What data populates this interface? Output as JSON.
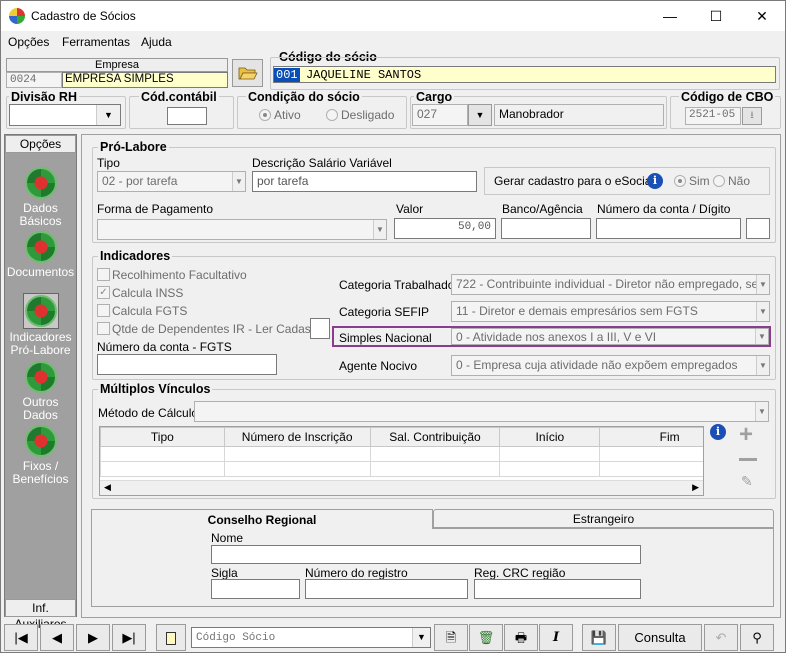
{
  "window": {
    "title": "Cadastro de Sócios",
    "minimize": "—",
    "maximize": "☐",
    "close": "✕"
  },
  "menu": {
    "opcoes": "Opções",
    "ferramentas": "Ferramentas",
    "ajuda": "Ajuda"
  },
  "empresa": {
    "header": "Empresa",
    "code": "0024",
    "name": "EMPRESA SIMPLES"
  },
  "socio": {
    "label": "Código do sócio",
    "code": "001",
    "name": "JAQUELINE SANTOS"
  },
  "top_row": {
    "divisao_label": "Divisão RH",
    "cod_contabil_label": "Cód.contábil",
    "condicao_label": "Condição do sócio",
    "ativo": "Ativo",
    "desligado": "Desligado",
    "cargo_label": "Cargo",
    "cargo_code": "027",
    "cargo_name": "Manobrador",
    "cbo_label": "Código de CBO",
    "cbo_value": "2521-05"
  },
  "sidebar": {
    "header": "Opções",
    "items": [
      {
        "label": "Dados Básicos"
      },
      {
        "label": "Documentos"
      },
      {
        "label": "Indicadores Pró-Labore"
      },
      {
        "label": "Outros Dados"
      },
      {
        "label": "Fixos / Benefícios"
      }
    ],
    "footer": "Inf. Auxiliares"
  },
  "pro_labore": {
    "title": "Pró-Labore",
    "tipo_label": "Tipo",
    "tipo_value": "02 - por tarefa",
    "desc_label": "Descrição Salário Variável",
    "desc_value": "por tarefa",
    "esocial_label": "Gerar cadastro para o eSocial:",
    "sim": "Sim",
    "nao": "Não",
    "forma_label": "Forma de Pagamento",
    "valor_label": "Valor",
    "valor_value": "50,00",
    "banco_label": "Banco/Agência",
    "conta_label": "Número da conta / Dígito"
  },
  "indicadores": {
    "title": "Indicadores",
    "recolhimento": "Recolhimento Facultativo",
    "calcula_inss": "Calcula INSS",
    "calcula_fgts": "Calcula FGTS",
    "qtde_dependentes": "Qtde de Dependentes IR - Ler Cadastro",
    "conta_fgts_label": "Número da conta - FGTS",
    "cat_trab_label": "Categoria Trabalhador",
    "cat_trab_value": "722 - Contribuinte individual - Diretor não empregado, sem FG",
    "cat_sefip_label": "Categoria SEFIP",
    "cat_sefip_value": "11 - Diretor e demais empresários sem FGTS",
    "simples_label": "Simples Nacional",
    "simples_value": "0 - Atividade nos anexos I a III, V e VI",
    "agente_label": "Agente Nocivo",
    "agente_value": "0 - Empresa cuja atividade não expõem empregados"
  },
  "multiplos": {
    "title": "Múltiplos Vínculos",
    "metodo_label": "Método de Cálculo",
    "columns": [
      "Tipo",
      "Número de Inscrição",
      "Sal. Contribuição",
      "Início",
      "Fim"
    ]
  },
  "conselho": {
    "tab1": "Conselho Regional",
    "tab2": "Estrangeiro",
    "nome_label": "Nome",
    "sigla_label": "Sigla",
    "numero_label": "Número do registro",
    "reg_label": "Reg. CRC região"
  },
  "bottom": {
    "codigo_socio_placeholder": "Código Sócio",
    "consulta": "Consulta"
  },
  "colors": {
    "highlight": "#8a3d8f",
    "select": "#0a4fb5",
    "yellow": "#ffffcc"
  }
}
